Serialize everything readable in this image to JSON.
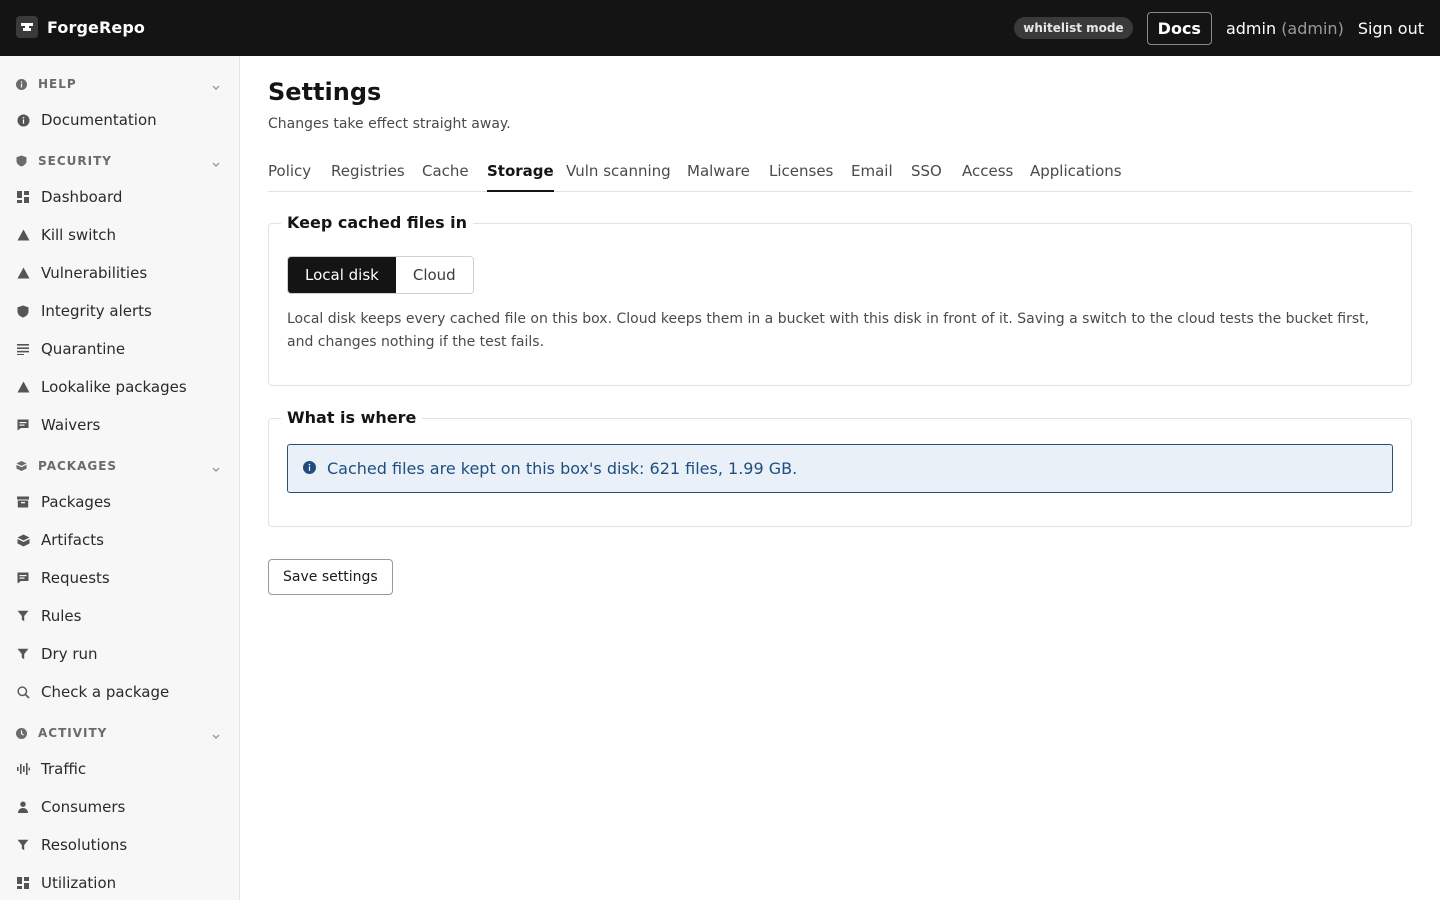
{
  "app": {
    "name": "ForgeRepo",
    "mode_badge": "whitelist mode",
    "docs_label": "Docs",
    "user_name": "admin",
    "user_role": "(admin)",
    "signout_label": "Sign out"
  },
  "sidebar": {
    "sections": [
      {
        "title": "HELP",
        "icon": "info-icon",
        "items": [
          {
            "label": "Documentation",
            "icon": "info-icon"
          }
        ]
      },
      {
        "title": "SECURITY",
        "icon": "shield-icon",
        "items": [
          {
            "label": "Dashboard",
            "icon": "grid-icon"
          },
          {
            "label": "Kill switch",
            "icon": "warning-icon"
          },
          {
            "label": "Vulnerabilities",
            "icon": "warning-icon"
          },
          {
            "label": "Integrity alerts",
            "icon": "shield-icon"
          },
          {
            "label": "Quarantine",
            "icon": "lines-icon"
          },
          {
            "label": "Lookalike packages",
            "icon": "warning-icon"
          },
          {
            "label": "Waivers",
            "icon": "note-icon"
          }
        ]
      },
      {
        "title": "PACKAGES",
        "icon": "box-icon",
        "items": [
          {
            "label": "Packages",
            "icon": "archive-icon"
          },
          {
            "label": "Artifacts",
            "icon": "box-icon"
          },
          {
            "label": "Requests",
            "icon": "note-icon"
          },
          {
            "label": "Rules",
            "icon": "filter-icon"
          },
          {
            "label": "Dry run",
            "icon": "filter-icon"
          },
          {
            "label": "Check a package",
            "icon": "search-icon"
          }
        ]
      },
      {
        "title": "ACTIVITY",
        "icon": "clock-icon",
        "items": [
          {
            "label": "Traffic",
            "icon": "bars-icon"
          },
          {
            "label": "Consumers",
            "icon": "person-icon"
          },
          {
            "label": "Resolutions",
            "icon": "filter-icon"
          },
          {
            "label": "Utilization",
            "icon": "grid-icon"
          }
        ]
      }
    ]
  },
  "page": {
    "title": "Settings",
    "subtitle": "Changes take effect straight away.",
    "tabs": [
      "Policy",
      "Registries",
      "Cache",
      "Storage",
      "Vuln scanning",
      "Malware",
      "Licenses",
      "Email",
      "SSO",
      "Access",
      "Applications"
    ],
    "active_tab": "Storage"
  },
  "storage": {
    "legend": "Keep cached files in",
    "options": [
      "Local disk",
      "Cloud"
    ],
    "selected": "Local disk",
    "description": "Local disk keeps every cached file on this box. Cloud keeps them in a bucket with this disk in front of it. Saving a switch to the cloud tests the bucket first, and changes nothing if the test fails."
  },
  "where": {
    "legend": "What is where",
    "info": "Cached files are kept on this box's disk: 621 files, 1.99 GB."
  },
  "actions": {
    "save_label": "Save settings"
  },
  "colors": {
    "topbar": "#141414",
    "sidebar_bg": "#f7f7f7",
    "info_bg": "#e9f0f8",
    "info_border": "#2e4f78",
    "info_text": "#1f4d80"
  }
}
